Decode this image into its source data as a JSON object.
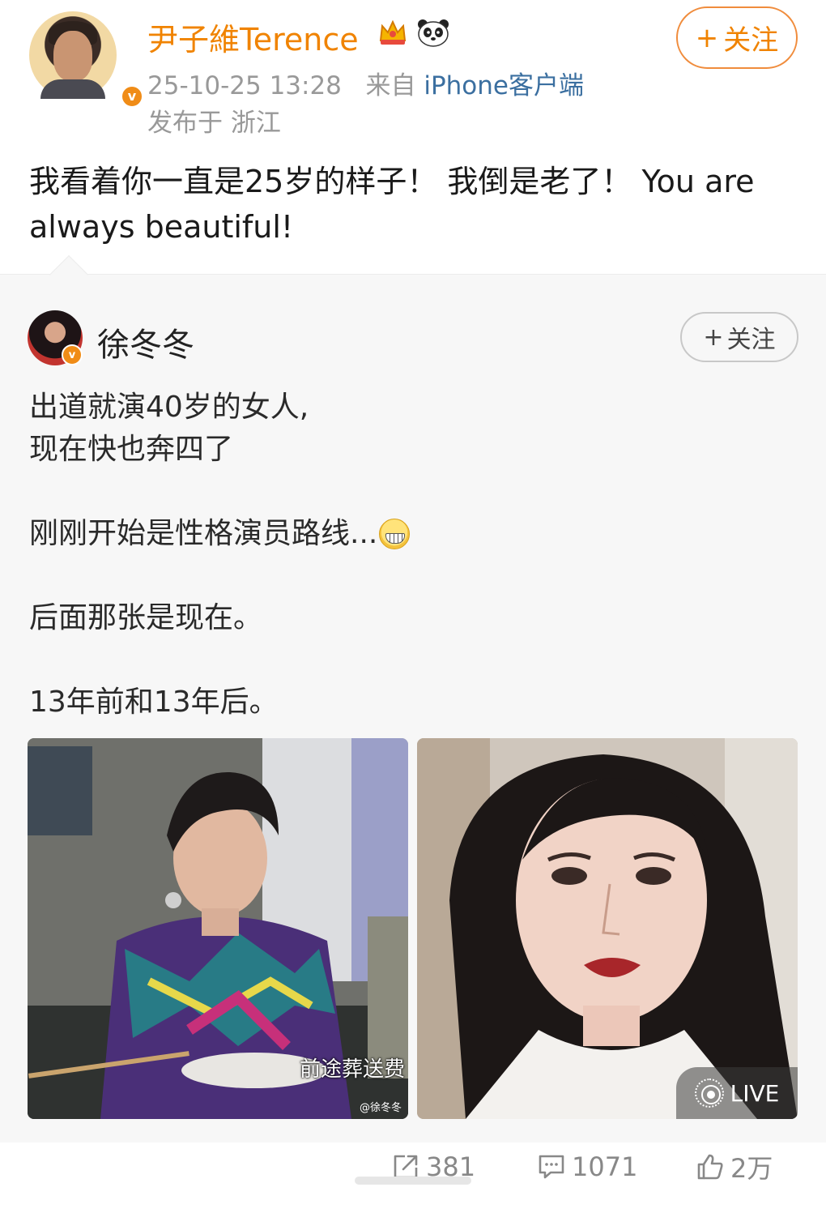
{
  "post": {
    "username": "尹子維Terence",
    "follow_label": "关注",
    "timestamp": "25-10-25 13:28",
    "source_prefix": "来自",
    "source_client": "iPhone客户端",
    "location": "发布于 浙江",
    "text": "我看着你一直是25岁的样子！ 我倒是老了！ You are always beautiful!",
    "badges": [
      "crown-icon",
      "panda-icon"
    ],
    "verified": "v"
  },
  "repost": {
    "username": "徐冬冬",
    "follow_label": "关注",
    "verified": "v",
    "lines": [
      "出道就演40岁的女人,",
      "现在快也奔四了",
      "",
      "刚刚开始是性格演员路线...",
      "",
      "后面那张是现在。",
      "",
      "13年前和13年后。"
    ],
    "images": [
      {
        "caption": "前途葬送费",
        "watermark": "@徐冬冬"
      },
      {
        "live_label": "LIVE"
      }
    ]
  },
  "actions": {
    "share_count": "381",
    "comment_count": "1071",
    "like_count": "2万"
  },
  "colors": {
    "accent_orange": "#f08300",
    "link_blue": "#3b6fa0",
    "meta_gray": "#999999"
  }
}
